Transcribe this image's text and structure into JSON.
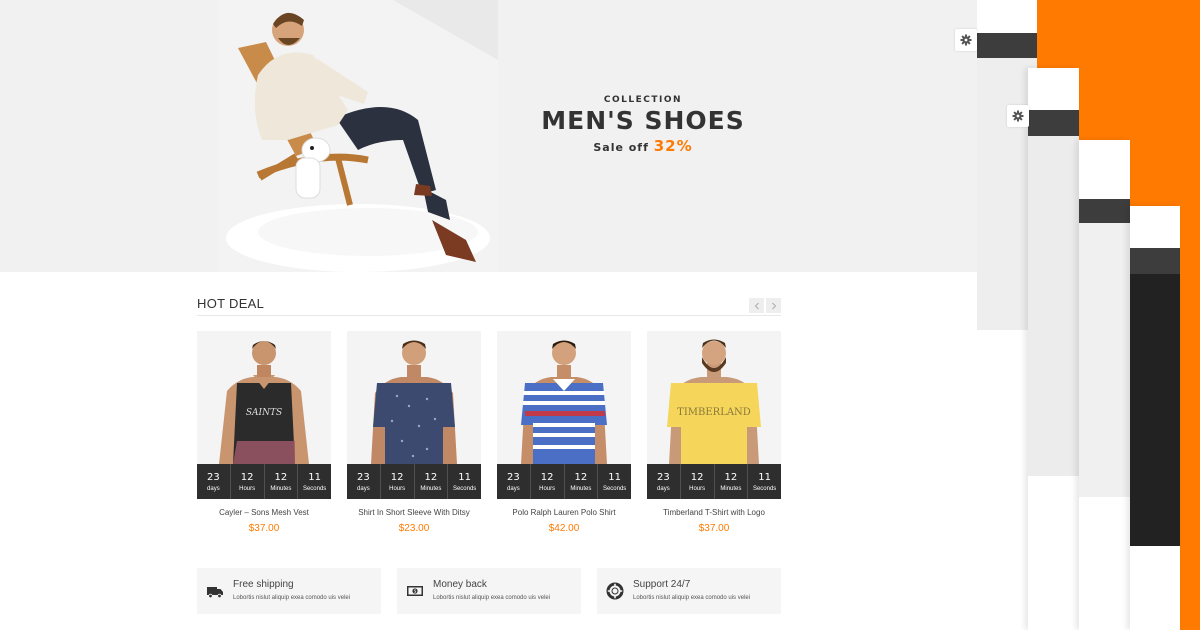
{
  "hero": {
    "kicker": "COLLECTION",
    "title": "MEN'S SHOES",
    "sale_prefix": "Sale off",
    "sale_value": "32%"
  },
  "hot_deal": {
    "title": "HOT DEAL",
    "prev_icon": "chevron-left-icon",
    "next_icon": "chevron-right-icon"
  },
  "countdown_labels": [
    "days",
    "Hours",
    "Minutes",
    "Seconds"
  ],
  "products": [
    {
      "name": "Cayler – Sons Mesh Vest",
      "price": "$37.00",
      "countdown": [
        "23",
        "12",
        "12",
        "11"
      ],
      "shirt_color": "#2b2b2b"
    },
    {
      "name": "Shirt In Short Sleeve With Ditsy",
      "price": "$23.00",
      "countdown": [
        "23",
        "12",
        "12",
        "11"
      ],
      "shirt_color": "#3b4a6e"
    },
    {
      "name": "Polo Ralph Lauren Polo Shirt",
      "price": "$42.00",
      "countdown": [
        "23",
        "12",
        "12",
        "11"
      ],
      "shirt_color": "#4b6fc4"
    },
    {
      "name": "Timberland T-Shirt with Logo",
      "price": "$37.00",
      "countdown": [
        "23",
        "12",
        "12",
        "11"
      ],
      "shirt_color": "#f5d55a"
    }
  ],
  "features": [
    {
      "title": "Free shipping",
      "desc": "Lobortis nislut aliquip exea comodo uis velei",
      "icon": "truck-icon"
    },
    {
      "title": "Money back",
      "desc": "Lobortis nislut aliquip exea comodo uis velei",
      "icon": "money-icon"
    },
    {
      "title": "Support 24/7",
      "desc": "Lobortis nislut aliquip exea comodo uis velei",
      "icon": "lifebuoy-icon"
    }
  ],
  "colors": {
    "accent": "#ff7a00",
    "dark": "#2e2e2e"
  }
}
